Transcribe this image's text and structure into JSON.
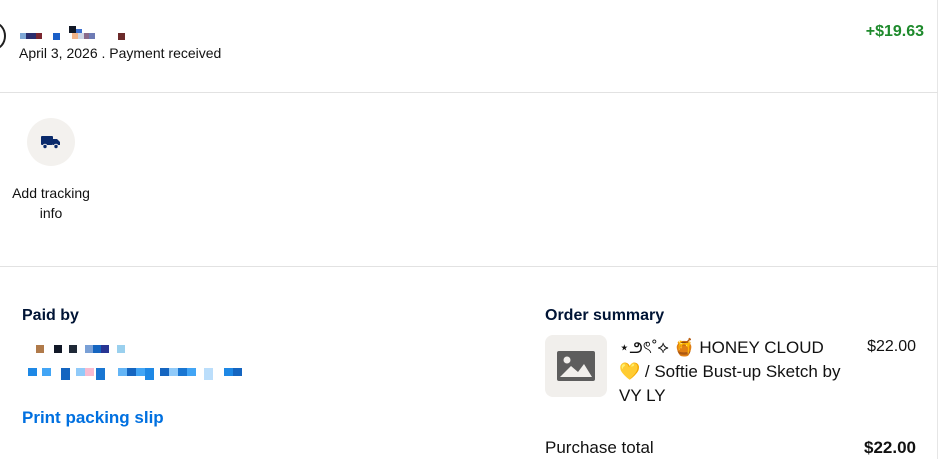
{
  "transaction": {
    "date_status": "April 3, 2026 . Payment received",
    "amount": "+$19.63",
    "amount_color": "#1e8a2c"
  },
  "tracking": {
    "icon": "truck-icon",
    "label": "Add tracking info"
  },
  "paid_by": {
    "title": "Paid by",
    "print_link": "Print packing slip"
  },
  "order_summary": {
    "title": "Order summary",
    "item_icon": "image-placeholder-icon",
    "item_name": "⋆౨ৎ˚⟡ 🍯 HONEY CLOUD 💛 / Softie Bust-up Sketch by VY LY",
    "item_price": "$22.00",
    "total_label": "Purchase total",
    "total_value": "$22.00"
  }
}
